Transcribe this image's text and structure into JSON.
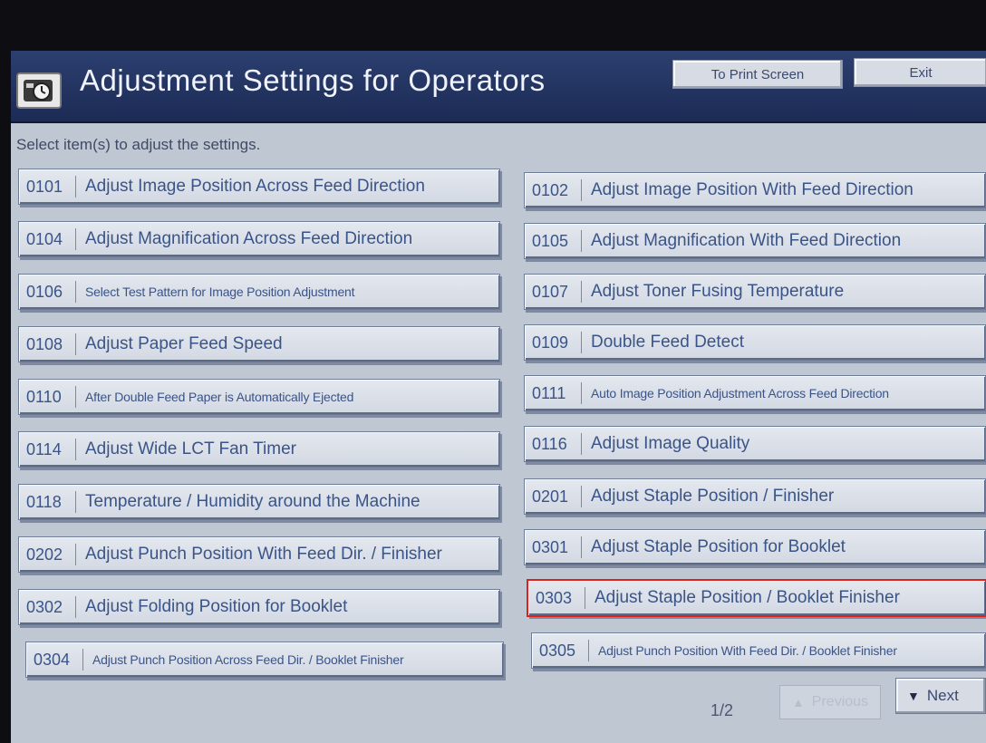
{
  "header": {
    "title": "Adjustment Settings for Operators",
    "print_label": "To Print Screen",
    "exit_label": "Exit"
  },
  "instruction": "Select item(s) to adjust the settings.",
  "items": [
    {
      "code": "0101",
      "label": "Adjust Image Position Across Feed Direction"
    },
    {
      "code": "0102",
      "label": "Adjust Image Position With Feed Direction"
    },
    {
      "code": "0104",
      "label": "Adjust Magnification Across Feed Direction"
    },
    {
      "code": "0105",
      "label": "Adjust Magnification With Feed Direction"
    },
    {
      "code": "0106",
      "label": "Select Test Pattern for Image Position Adjustment"
    },
    {
      "code": "0107",
      "label": "Adjust Toner Fusing Temperature"
    },
    {
      "code": "0108",
      "label": "Adjust Paper Feed Speed"
    },
    {
      "code": "0109",
      "label": "Double Feed Detect"
    },
    {
      "code": "0110",
      "label": "After Double Feed Paper is Automatically Ejected"
    },
    {
      "code": "0111",
      "label": "Auto Image Position Adjustment Across Feed Direction"
    },
    {
      "code": "0114",
      "label": "Adjust Wide LCT Fan Timer"
    },
    {
      "code": "0116",
      "label": "Adjust Image Quality"
    },
    {
      "code": "0118",
      "label": "Temperature / Humidity around the Machine"
    },
    {
      "code": "0201",
      "label": "Adjust Staple Position / Finisher"
    },
    {
      "code": "0202",
      "label": "Adjust Punch Position With Feed Dir. / Finisher"
    },
    {
      "code": "0301",
      "label": "Adjust Staple Position for Booklet"
    },
    {
      "code": "0302",
      "label": "Adjust Folding Position for Booklet"
    },
    {
      "code": "0303",
      "label": "Adjust Staple Position / Booklet Finisher"
    },
    {
      "code": "0304",
      "label": "Adjust Punch Position Across Feed Dir. / Booklet Finisher"
    },
    {
      "code": "0305",
      "label": "Adjust Punch Position With Feed Dir. / Booklet Finisher"
    }
  ],
  "pagination": {
    "page_indicator": "1/2",
    "prev_label": "Previous",
    "next_label": "Next"
  },
  "icons": {
    "app": "timer-icon",
    "prev_arrow": "up-arrow-icon",
    "next_arrow": "down-arrow-icon"
  }
}
